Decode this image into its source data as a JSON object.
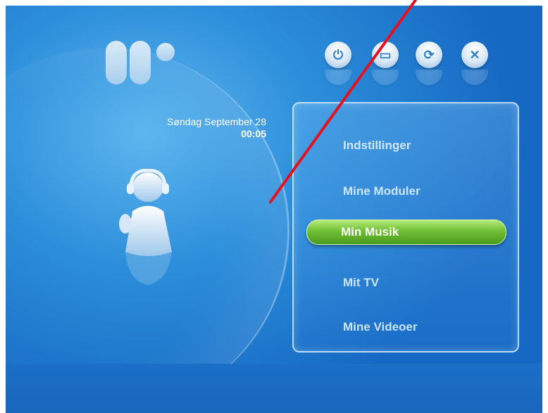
{
  "header": {
    "date": "Søndag September 28",
    "time": "00:05"
  },
  "controls": [
    {
      "name": "power-icon",
      "glyph": "⏻"
    },
    {
      "name": "window-icon",
      "glyph": "▭"
    },
    {
      "name": "refresh-icon",
      "glyph": "⟳"
    },
    {
      "name": "close-icon",
      "glyph": "✕"
    }
  ],
  "menu": {
    "items": [
      {
        "label": "Indstillinger"
      },
      {
        "label": "Mine Moduler"
      },
      {
        "label": "Min Musik"
      },
      {
        "label": "Mit TV"
      },
      {
        "label": "Mine Videoer"
      }
    ],
    "selected_index": 2
  },
  "colors": {
    "accent": "#6fbf34",
    "background": "#2d8fdb",
    "annotation_line": "#e8101d"
  }
}
